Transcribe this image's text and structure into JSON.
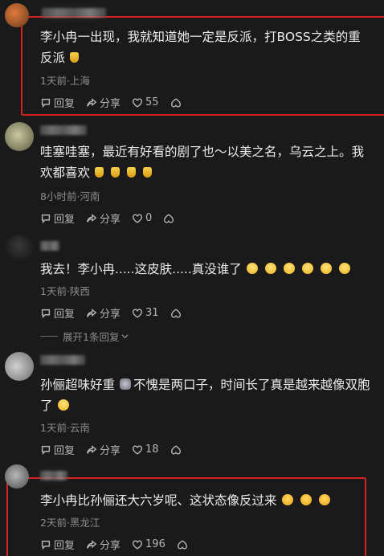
{
  "colors": {
    "background": "#1a1a1a",
    "highlight": "#d62222"
  },
  "action_labels": {
    "reply": "回复",
    "share": "分享"
  },
  "comments": [
    {
      "text_line1": "李小冉一出现，我就知道她一定是反派，打BOSS之类的重",
      "text_line2": "反派",
      "emojis": [
        "trophy"
      ],
      "meta": "1天前·上海",
      "likes": "55"
    },
    {
      "text_line1": "哇塞哇塞，最近有好看的剧了也～以美之名，乌云之上。我",
      "text_line2": "欢都喜欢",
      "emojis": [
        "trophy",
        "trophy",
        "trophy",
        "trophy"
      ],
      "meta": "8小时前·河南",
      "likes": "0"
    },
    {
      "text_line1": "我去！李小冉.....这皮肤.....真没谁了",
      "text_line2": "",
      "emojis": [
        "grin",
        "grin",
        "grin",
        "grin",
        "grin",
        "grin"
      ],
      "meta": "1天前·陕西",
      "likes": "31",
      "expand_replies": "展开1条回复"
    },
    {
      "text_line1": "孙俪超味好重",
      "text_line1b": "不愧是两口子，时间长了真是越来越像双胞",
      "text_line2": "了",
      "emojis": [
        "grin"
      ],
      "meta": "1天前·云南",
      "likes": "18"
    },
    {
      "text_line1": "李小冉比孙俪还大六岁呢、这状态像反过来",
      "text_line2": "",
      "emojis": [
        "laugh",
        "laugh",
        "laugh"
      ],
      "meta": "2天前·黑龙江",
      "likes": "196"
    }
  ]
}
